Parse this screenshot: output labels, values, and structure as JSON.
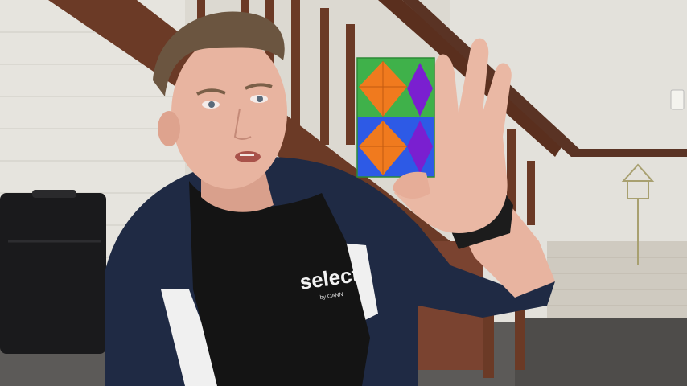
{
  "scene": {
    "shirt_logo": "select",
    "shirt_logo_sub": "by CANN"
  },
  "colors": {
    "wall": "#dcd9d1",
    "shiplap": "#e4e2dc",
    "stair_wood": "#6b3a26",
    "jacket": "#1f2a44",
    "jacket_stripe": "#f0f0f0",
    "shirt": "#141414",
    "skin": "#e8b4a0",
    "hair": "#6b5540",
    "cube_orange": "#f07a1e",
    "cube_green": "#3fb14a",
    "cube_purple": "#7a1fd0",
    "cube_blue": "#2d5ae6"
  },
  "icons": [
    "suitcase",
    "staircase",
    "wall-outlet",
    "puzzle-cube",
    "wristwatch"
  ]
}
